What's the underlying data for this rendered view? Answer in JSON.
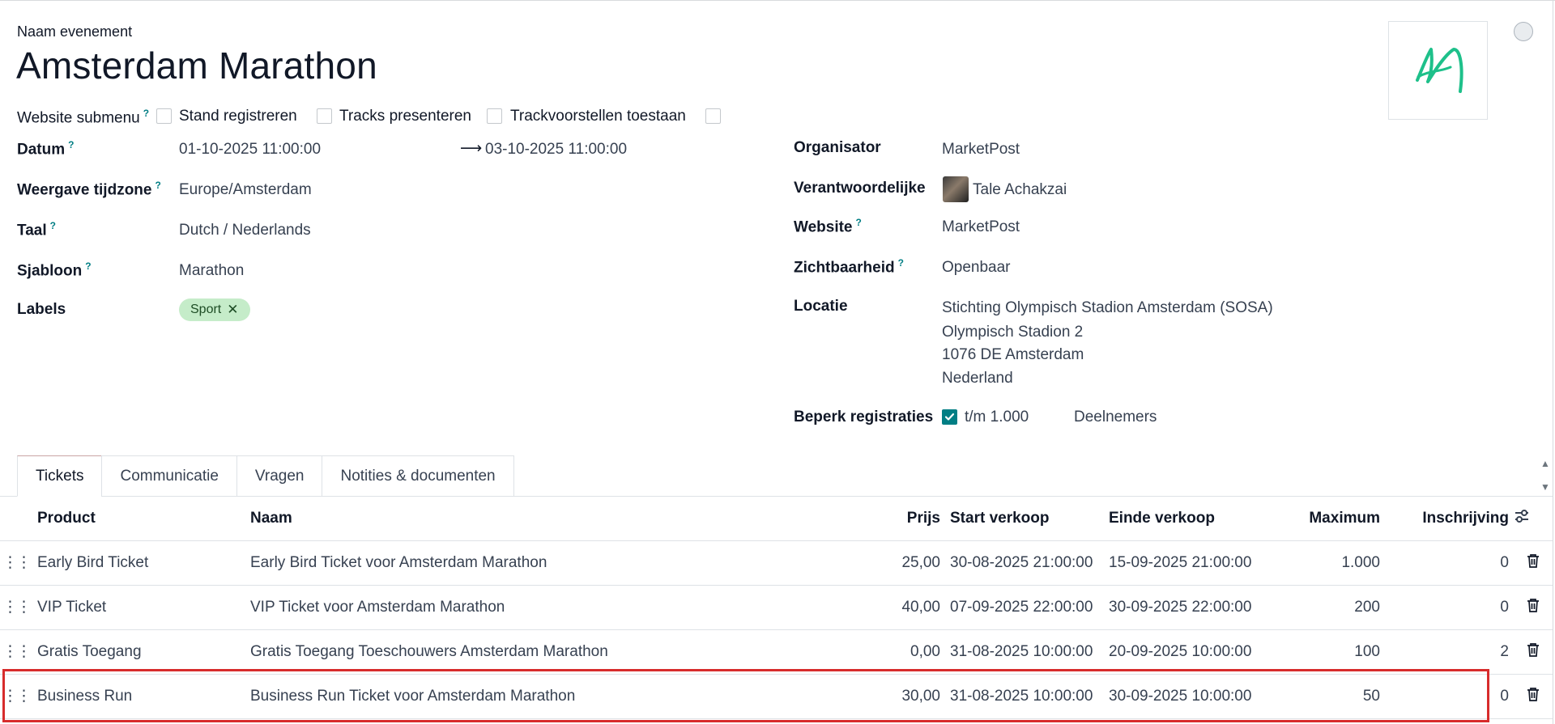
{
  "header": {
    "name_label": "Naam evenement",
    "event_name": "Amsterdam Marathon"
  },
  "submenu_row": {
    "website_submenu": "Website submenu",
    "stand_register": "Stand registreren",
    "tracks_present": "Tracks presenteren",
    "track_proposals": "Trackvoorstellen toestaan"
  },
  "left_fields": {
    "datum_label": "Datum",
    "datum_start": "01-10-2025 11:00:00",
    "datum_end": "03-10-2025 11:00:00",
    "tz_label": "Weergave tijdzone",
    "tz_value": "Europe/Amsterdam",
    "lang_label": "Taal",
    "lang_value": "Dutch / Nederlands",
    "template_label": "Sjabloon",
    "template_value": "Marathon",
    "labels_label": "Labels",
    "tag": "Sport"
  },
  "right_fields": {
    "organizer_label": "Organisator",
    "organizer_value": "MarketPost",
    "responsible_label": "Verantwoordelijke",
    "responsible_value": "Tale Achakzai",
    "website_label": "Website",
    "website_value": "MarketPost",
    "visibility_label": "Zichtbaarheid",
    "visibility_value": "Openbaar",
    "location_label": "Locatie",
    "location_lines": [
      "Stichting Olympisch Stadion Amsterdam (SOSA)",
      "Olympisch Stadion 2",
      "1076 DE Amsterdam",
      "Nederland"
    ],
    "limit_label": "Beperk registraties",
    "limit_value": "t/m 1.000",
    "limit_unit": "Deelnemers"
  },
  "tabs": [
    "Tickets",
    "Communicatie",
    "Vragen",
    "Notities & documenten"
  ],
  "table": {
    "headers": {
      "product": "Product",
      "naam": "Naam",
      "prijs": "Prijs",
      "start": "Start verkoop",
      "einde": "Einde verkoop",
      "maximum": "Maximum",
      "inschrijving": "Inschrijving"
    },
    "rows": [
      {
        "product": "Early Bird Ticket",
        "naam": "Early Bird Ticket voor Amsterdam Marathon",
        "prijs": "25,00",
        "start": "30-08-2025 21:00:00",
        "einde": "15-09-2025 21:00:00",
        "maximum": "1.000",
        "inschrijving": "0"
      },
      {
        "product": "VIP Ticket",
        "naam": "VIP Ticket voor Amsterdam Marathon",
        "prijs": "40,00",
        "start": "07-09-2025 22:00:00",
        "einde": "30-09-2025 22:00:00",
        "maximum": "200",
        "inschrijving": "0"
      },
      {
        "product": "Gratis Toegang",
        "naam": "Gratis Toegang Toeschouwers Amsterdam Marathon",
        "prijs": "0,00",
        "start": "31-08-2025 10:00:00",
        "einde": "20-09-2025 10:00:00",
        "maximum": "100",
        "inschrijving": "2"
      },
      {
        "product": "Business Run",
        "naam": "Business Run Ticket voor Amsterdam Marathon",
        "prijs": "30,00",
        "start": "31-08-2025 10:00:00",
        "einde": "30-09-2025 10:00:00",
        "maximum": "50",
        "inschrijving": "0"
      }
    ]
  },
  "colors": {
    "accent": "#017e84",
    "tag_bg": "#c5ecc9",
    "highlight": "#d72c2c",
    "logo": "#1ec08a"
  }
}
